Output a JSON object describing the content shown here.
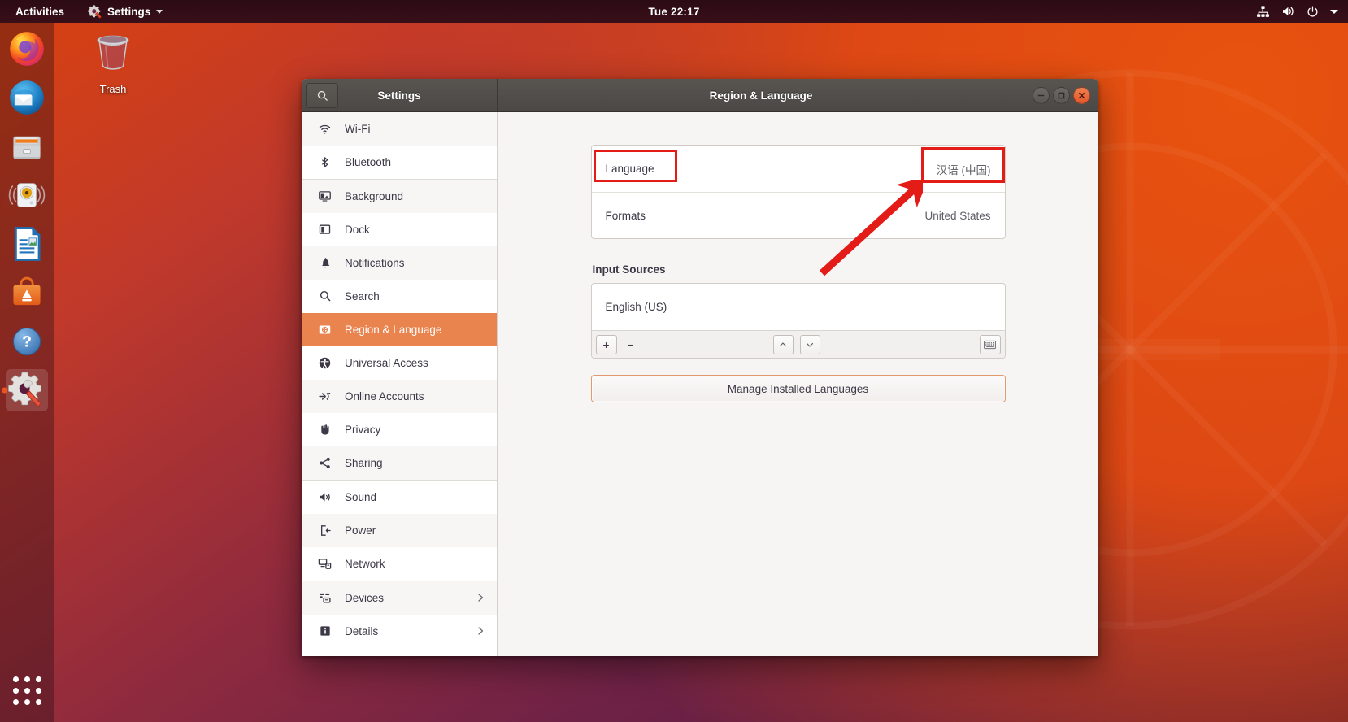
{
  "topbar": {
    "activities": "Activities",
    "app_menu": "Settings",
    "clock": "Tue 22:17",
    "indicators": [
      "network-icon",
      "volume-icon",
      "power-icon",
      "chevron-down-icon"
    ]
  },
  "desktop": {
    "icons": [
      {
        "label": "Trash",
        "icon": "trash-icon"
      }
    ]
  },
  "dock": {
    "items": [
      {
        "name": "firefox",
        "tooltip": "Firefox Web Browser",
        "active": false
      },
      {
        "name": "thunderbird",
        "tooltip": "Thunderbird Mail",
        "active": false
      },
      {
        "name": "files",
        "tooltip": "Files",
        "active": false
      },
      {
        "name": "rhythmbox",
        "tooltip": "Rhythmbox",
        "active": false
      },
      {
        "name": "libreoffice-writer",
        "tooltip": "LibreOffice Writer",
        "active": false
      },
      {
        "name": "ubuntu-software",
        "tooltip": "Ubuntu Software",
        "active": false
      },
      {
        "name": "help",
        "tooltip": "Help",
        "active": false
      },
      {
        "name": "settings",
        "tooltip": "Settings",
        "active": true
      }
    ],
    "app_grid": "Show Applications"
  },
  "window": {
    "left_title": "Settings",
    "right_title": "Region & Language",
    "search_icon": "search-icon",
    "controls": {
      "minimize": "−",
      "maximize": "□",
      "close": "×"
    }
  },
  "sidebar": {
    "items": [
      {
        "label": "Wi-Fi",
        "icon": "wifi-icon",
        "selected": false,
        "chevron": false
      },
      {
        "label": "Bluetooth",
        "icon": "bluetooth-icon",
        "selected": false,
        "chevron": false
      },
      {
        "label": "Background",
        "icon": "background-icon",
        "selected": false,
        "chevron": false
      },
      {
        "label": "Dock",
        "icon": "dock-icon",
        "selected": false,
        "chevron": false
      },
      {
        "label": "Notifications",
        "icon": "bell-icon",
        "selected": false,
        "chevron": false
      },
      {
        "label": "Search",
        "icon": "search-icon",
        "selected": false,
        "chevron": false
      },
      {
        "label": "Region & Language",
        "icon": "region-language-icon",
        "selected": true,
        "chevron": false
      },
      {
        "label": "Universal Access",
        "icon": "universal-access-icon",
        "selected": false,
        "chevron": false
      },
      {
        "label": "Online Accounts",
        "icon": "online-accounts-icon",
        "selected": false,
        "chevron": false
      },
      {
        "label": "Privacy",
        "icon": "privacy-hand-icon",
        "selected": false,
        "chevron": false
      },
      {
        "label": "Sharing",
        "icon": "sharing-icon",
        "selected": false,
        "chevron": false
      },
      {
        "label": "Sound",
        "icon": "sound-icon",
        "selected": false,
        "chevron": false
      },
      {
        "label": "Power",
        "icon": "power-plug-icon",
        "selected": false,
        "chevron": false
      },
      {
        "label": "Network",
        "icon": "network-icon",
        "selected": false,
        "chevron": false
      },
      {
        "label": "Devices",
        "icon": "devices-icon",
        "selected": false,
        "chevron": true
      },
      {
        "label": "Details",
        "icon": "details-info-icon",
        "selected": false,
        "chevron": true
      }
    ]
  },
  "content": {
    "language_row": {
      "label": "Language",
      "value": "汉语 (中国)"
    },
    "formats_row": {
      "label": "Formats",
      "value": "United States"
    },
    "input_sources": {
      "title": "Input Sources",
      "entries": [
        "English (US)"
      ],
      "toolbar": {
        "add": "+",
        "remove": "−",
        "move_up": "move-up-icon",
        "move_down": "move-down-icon",
        "keyboard_layout": "keyboard-icon"
      }
    },
    "manage_button": "Manage Installed Languages"
  },
  "annotations": {
    "highlight_color": "#e31c18",
    "boxes": [
      {
        "target": "language-label"
      },
      {
        "target": "language-value"
      }
    ],
    "arrow": {
      "from": "formats-row-area",
      "to": "language-value"
    }
  }
}
